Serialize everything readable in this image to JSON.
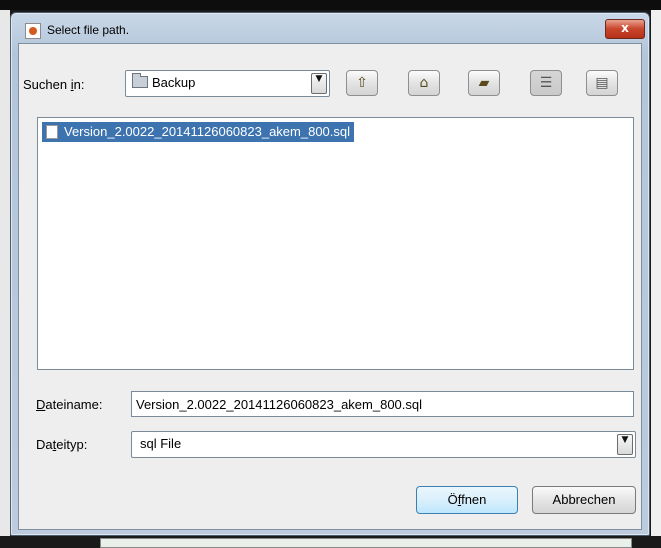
{
  "window": {
    "title": "Select file path.",
    "close_label": "x"
  },
  "lookin": {
    "label_prefix": "Suchen ",
    "label_mnemonic": "i",
    "label_suffix": "n:",
    "value": "Backup"
  },
  "toolbar": {
    "icons": [
      "up-folder-icon",
      "home-icon",
      "new-folder-icon",
      "list-view-icon",
      "details-view-icon"
    ]
  },
  "files": {
    "items": [
      "Version_2.0022_20141126060823_akem_800.sql"
    ]
  },
  "filename": {
    "label_mnemonic": "D",
    "label_rest": "ateiname:",
    "value": "Version_2.0022_20141126060823_akem_800.sql"
  },
  "filetype": {
    "label_prefix": "Da",
    "label_mnemonic": "t",
    "label_suffix": "eityp:",
    "value": "sql File"
  },
  "buttons": {
    "open_prefix": "Ö",
    "open_mnemonic": "f",
    "open_suffix": "fnen",
    "cancel": "Abbrechen"
  }
}
